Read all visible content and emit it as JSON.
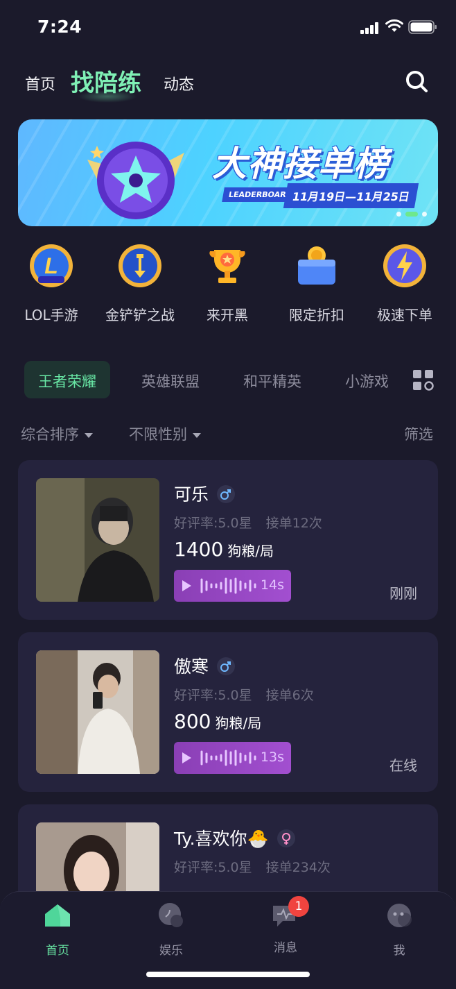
{
  "status_bar": {
    "time": "7:24"
  },
  "top_nav": {
    "tabs": [
      {
        "label": "首页"
      },
      {
        "label": "找陪练"
      },
      {
        "label": "动态"
      }
    ],
    "active_tab": "找陪练"
  },
  "banner": {
    "title": "大神接单榜",
    "subtitle_en": "LEADERBOARD",
    "date_range": "11月19日—11月25日"
  },
  "quick_categories": [
    {
      "label": "LOL手游",
      "icon": "lol-mobile-icon"
    },
    {
      "label": "金铲铲之战",
      "icon": "golden-shovel-icon"
    },
    {
      "label": "来开黑",
      "icon": "trophy-icon"
    },
    {
      "label": "限定折扣",
      "icon": "discount-box-icon"
    },
    {
      "label": "极速下单",
      "icon": "lightning-icon"
    }
  ],
  "game_tabs": [
    {
      "label": "王者荣耀"
    },
    {
      "label": "英雄联盟"
    },
    {
      "label": "和平精英"
    },
    {
      "label": "小游戏"
    }
  ],
  "filters": {
    "sort": "综合排序",
    "gender": "不限性别",
    "filter": "筛选"
  },
  "players": [
    {
      "name": "可乐",
      "gender": "male",
      "rating": "好评率:5.0星",
      "orders": "接单12次",
      "price": "1400",
      "unit": "狗粮/局",
      "voice_duration": "14s",
      "status": "刚刚"
    },
    {
      "name": "傲寒",
      "gender": "male",
      "rating": "好评率:5.0星",
      "orders": "接单6次",
      "price": "800",
      "unit": "狗粮/局",
      "voice_duration": "13s",
      "status": "在线"
    },
    {
      "name": "Ty.喜欢你🐣",
      "gender": "female",
      "rating": "好评率:5.0星",
      "orders": "接单234次",
      "price": "",
      "unit": "",
      "voice_duration": "",
      "status": ""
    }
  ],
  "bottom_nav": [
    {
      "label": "首页",
      "icon": "home-icon"
    },
    {
      "label": "娱乐",
      "icon": "entertainment-icon"
    },
    {
      "label": "消息",
      "icon": "message-icon",
      "badge": "1"
    },
    {
      "label": "我",
      "icon": "profile-icon"
    }
  ],
  "colors": {
    "background": "#1b1a2b",
    "card": "#25233d",
    "accent_green": "#68e6a4",
    "voice_purple": "#a24fd0",
    "badge_red": "#f0443f"
  }
}
